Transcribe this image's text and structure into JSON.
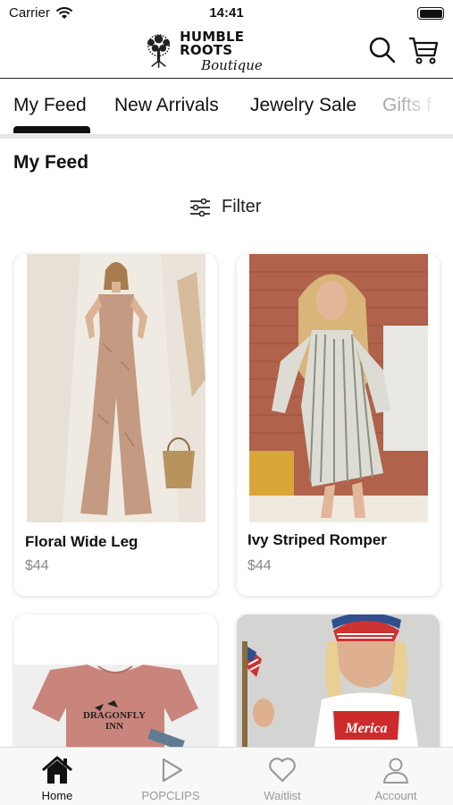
{
  "status_bar": {
    "carrier": "Carrier",
    "time": "14:41"
  },
  "header": {
    "logo_line1": "HUMBLE ROOTS",
    "logo_line2": "Boutique",
    "search_icon": "search-icon",
    "cart_icon": "cart-icon"
  },
  "tabs": [
    {
      "label": "My Feed",
      "active": true
    },
    {
      "label": "New Arrivals"
    },
    {
      "label": "Jewelry Sale"
    },
    {
      "label": "Gifts f"
    }
  ],
  "feed": {
    "title": "My Feed",
    "filter_label": "Filter"
  },
  "products": [
    {
      "name": "Floral Wide Leg",
      "price": "$44"
    },
    {
      "name": "Ivy Striped Romper",
      "price": "$44"
    },
    {
      "name": "",
      "price": "",
      "print_lines": [
        "DRAGONFLY",
        "INN"
      ]
    },
    {
      "name": "",
      "price": "",
      "print_text": "Merica"
    }
  ],
  "tabbar": [
    {
      "label": "Home",
      "icon": "home-icon",
      "active": true
    },
    {
      "label": "POPCLIPS",
      "icon": "play-icon"
    },
    {
      "label": "Waitlist",
      "icon": "heart-icon"
    },
    {
      "label": "Account",
      "icon": "person-icon"
    }
  ],
  "colors": {
    "accent": "#111111",
    "inactive": "#999999"
  }
}
